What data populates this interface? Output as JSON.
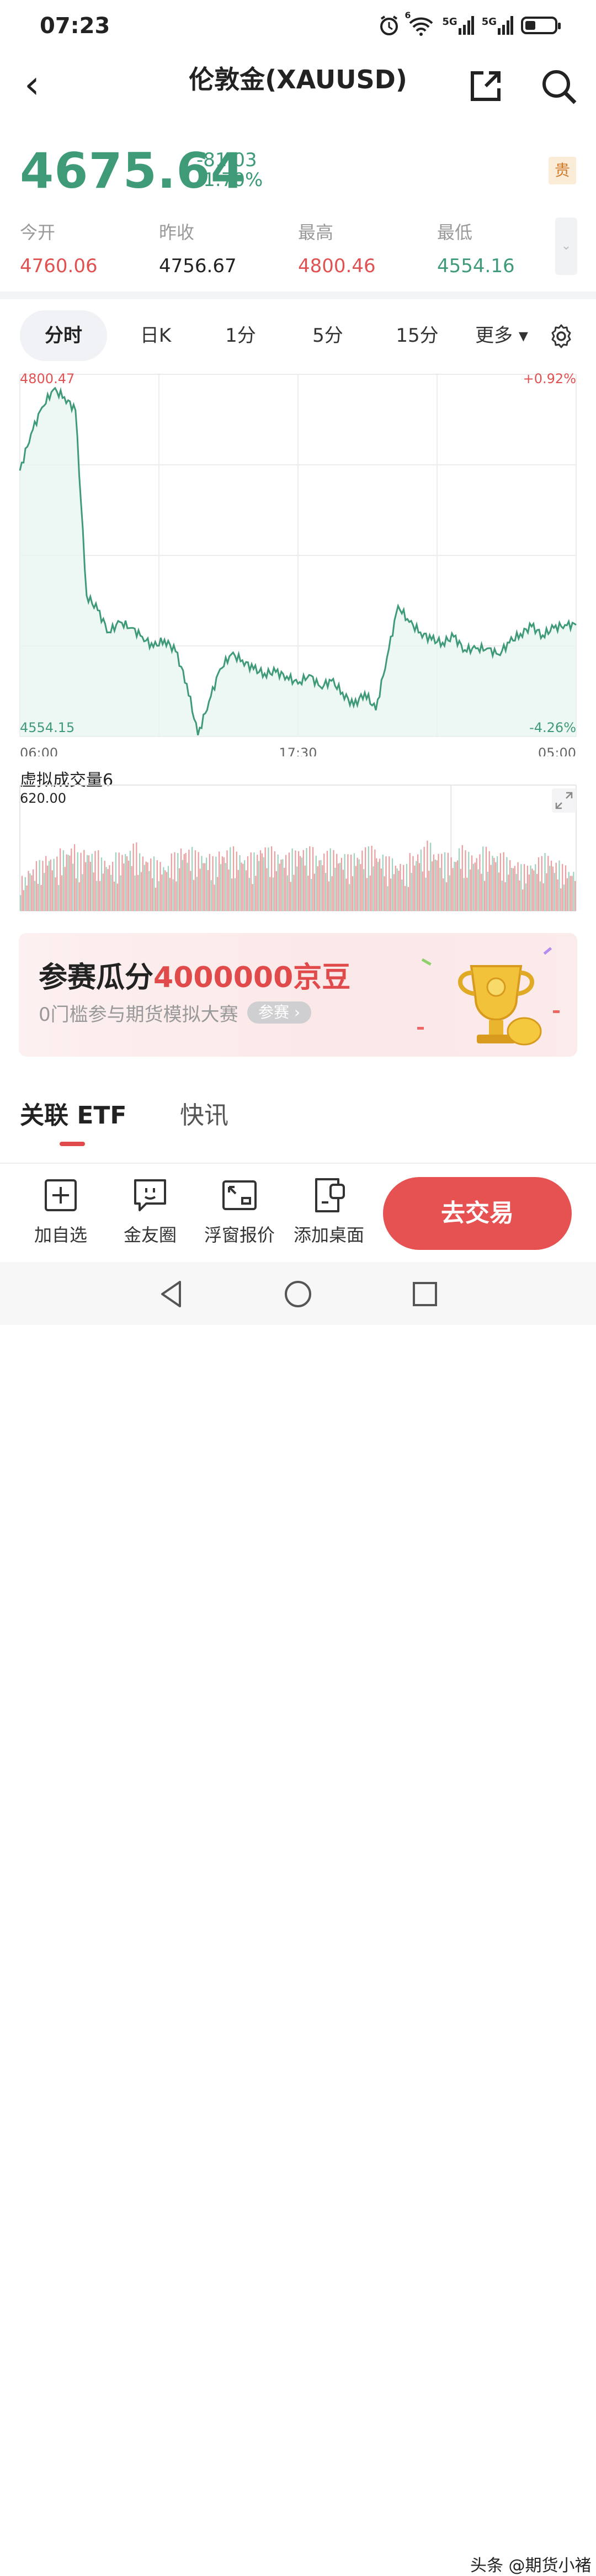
{
  "status_bar": {
    "time": "07:23",
    "signal1": "5G",
    "signal2": "5G",
    "wifi_badge": "6"
  },
  "header": {
    "back_glyph": "‹",
    "title": "伦敦金(XAUUSD)",
    "share_icon": "share-icon",
    "search_icon": "search-icon"
  },
  "quote": {
    "price": "4675.64",
    "change": "-81.03",
    "change_pct": "-1.70%",
    "badge": "贵",
    "stats": [
      {
        "label": "今开",
        "value": "4760.06",
        "tone": "red"
      },
      {
        "label": "昨收",
        "value": "4756.67",
        "tone": "dark"
      },
      {
        "label": "最高",
        "value": "4800.46",
        "tone": "red"
      },
      {
        "label": "最低",
        "value": "4554.16",
        "tone": "green"
      }
    ],
    "expand_glyph": "⌄"
  },
  "tabs": {
    "items": [
      "分时",
      "日K",
      "1分",
      "5分",
      "15分",
      "更多 ▾"
    ],
    "active": 0
  },
  "chart_data": [
    {
      "type": "line",
      "title": "",
      "y_top_label": "4800.47",
      "y_bottom_label": "4554.15",
      "pct_top_label": "+0.92%",
      "pct_bottom_label": "-4.26%",
      "x_tick_labels": [
        "06:00",
        "17:30",
        "05:00"
      ],
      "ylim": [
        4554.15,
        4800.47
      ],
      "x": [
        0,
        2,
        4,
        6,
        8,
        10,
        12,
        14,
        16,
        18,
        20,
        22,
        24,
        26,
        28,
        30,
        32,
        34,
        36,
        38,
        40,
        42,
        44,
        46,
        48,
        50,
        52,
        54,
        56,
        58,
        60,
        62,
        64,
        66,
        68,
        70,
        72,
        74,
        76,
        78,
        80,
        82,
        84,
        86,
        88,
        90,
        92,
        94,
        96,
        98,
        100
      ],
      "values": [
        4735,
        4760,
        4778,
        4790,
        4785,
        4776,
        4650,
        4640,
        4625,
        4632,
        4628,
        4622,
        4615,
        4620,
        4612,
        4590,
        4555,
        4578,
        4600,
        4610,
        4606,
        4600,
        4597,
        4598,
        4595,
        4590,
        4596,
        4588,
        4592,
        4584,
        4575,
        4584,
        4572,
        4608,
        4643,
        4632,
        4625,
        4620,
        4618,
        4622,
        4613,
        4614,
        4614,
        4610,
        4618,
        4624,
        4629,
        4623,
        4628,
        4630,
        4630
      ],
      "color": "#3f9a78"
    },
    {
      "type": "bar",
      "title": "虚拟成交量6",
      "y_max_label": "620.00",
      "values": [
        180,
        230,
        260,
        300,
        280,
        320,
        350,
        300,
        330,
        310,
        280,
        260,
        300,
        330,
        350,
        300,
        280,
        260,
        250,
        300,
        340,
        330,
        310,
        300,
        280,
        320,
        330,
        310,
        290,
        300,
        350,
        330,
        310,
        300,
        320,
        340,
        330,
        300,
        310,
        320,
        300,
        290,
        310,
        330,
        340,
        300,
        280,
        260,
        240,
        300,
        330,
        360,
        320,
        300,
        290,
        340,
        310,
        300,
        330,
        320,
        300,
        280,
        260,
        240,
        260,
        280,
        300,
        260,
        240,
        220
      ],
      "colors": [
        "#e8a0a0",
        "#9fd3bf"
      ],
      "ylim": [
        0,
        620
      ]
    }
  ],
  "promo": {
    "title_prefix": "参赛瓜分",
    "title_highlight": "4000000京豆",
    "subtitle": "0门槛参与期货模拟大赛",
    "button": "参赛 ›"
  },
  "sections": {
    "tabs": [
      "关联 ETF",
      "快讯"
    ],
    "active": 0
  },
  "bottom_bar": {
    "items": [
      {
        "label": "加自选",
        "icon": "add-watchlist-icon"
      },
      {
        "label": "金友圈",
        "icon": "community-icon"
      },
      {
        "label": "浮窗报价",
        "icon": "floating-window-icon"
      },
      {
        "label": "添加桌面",
        "icon": "add-desktop-icon"
      }
    ],
    "trade_button": "去交易"
  },
  "watermark": "头条 @期货小褚"
}
